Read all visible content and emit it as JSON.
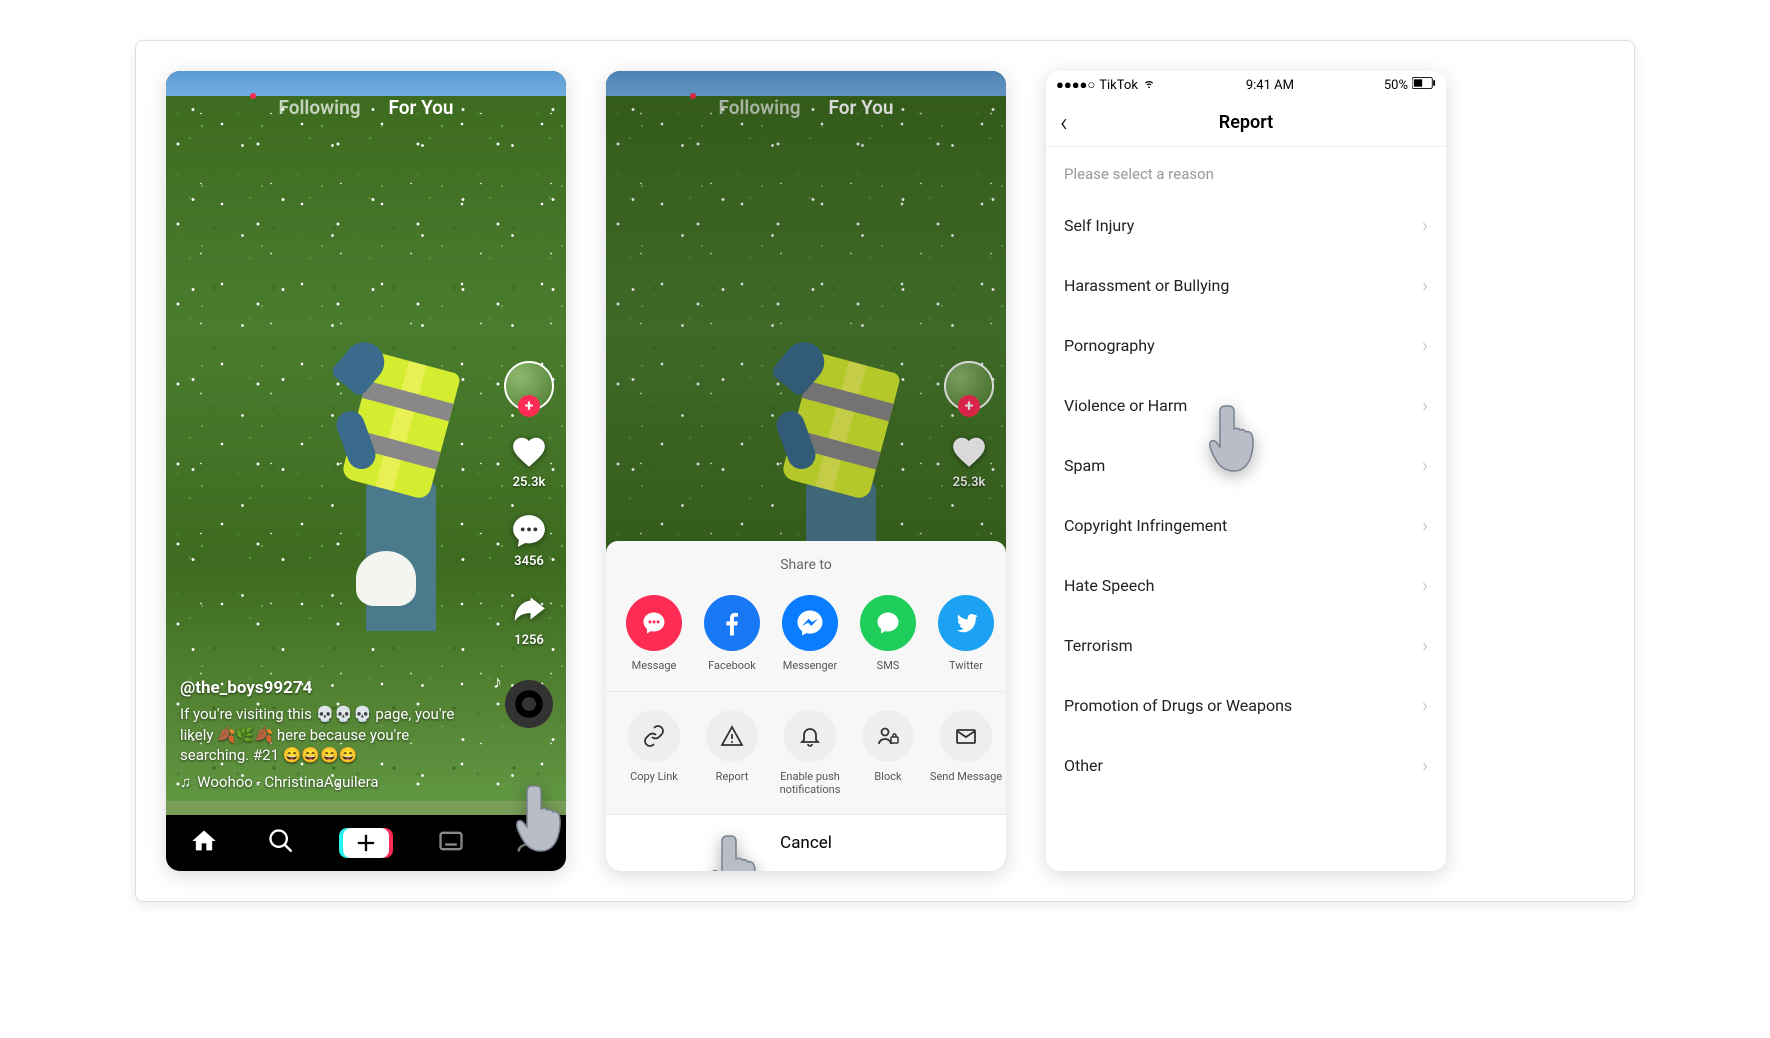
{
  "feed": {
    "tabs": {
      "following": "Following",
      "forYou": "For You"
    },
    "actions": {
      "likes": "25.3k",
      "comments": "3456",
      "shares": "1256"
    },
    "caption": {
      "username": "@the_boys99274",
      "text": "If you're visiting this 💀💀💀 page, you're likely 🍂🌿🍂 here because you're searching. #21 😄😄😄😄",
      "sound": "Woohoo - ChristinaAguilera"
    }
  },
  "share": {
    "title": "Share to",
    "apps": [
      {
        "label": "Message",
        "bg": "#fe2c55"
      },
      {
        "label": "Facebook",
        "bg": "#1877f2"
      },
      {
        "label": "Messenger",
        "bg": "#0a7cff"
      },
      {
        "label": "SMS",
        "bg": "#1fce5a"
      },
      {
        "label": "Twitter",
        "bg": "#1da1f2"
      }
    ],
    "actions": [
      {
        "label": "Copy Link"
      },
      {
        "label": "Report"
      },
      {
        "label": "Enable push notifications"
      },
      {
        "label": "Block"
      },
      {
        "label": "Send Message"
      }
    ],
    "cancel": "Cancel"
  },
  "report": {
    "status": {
      "carrier": "TikTok",
      "time": "9:41 AM",
      "battery": "50%"
    },
    "title": "Report",
    "subtitle": "Please select a reason",
    "reasons": [
      "Self Injury",
      "Harassment or Bullying",
      "Pornography",
      "Violence or Harm",
      "Spam",
      "Copyright Infringement",
      "Hate Speech",
      "Terrorism",
      "Promotion of Drugs or Weapons",
      "Other"
    ]
  }
}
